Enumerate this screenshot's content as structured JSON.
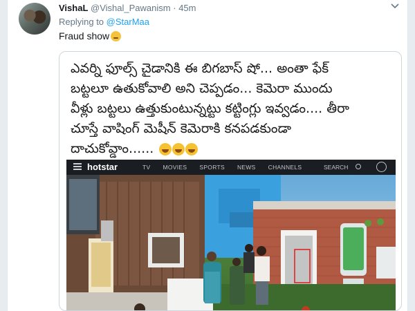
{
  "tweet": {
    "name": "VishaL",
    "handle": "@Vishal_Pawanism",
    "separator": "·",
    "time": "45m",
    "replying_prefix": "Replying to",
    "replying_to": "@StarMaa",
    "text": "Fraud show",
    "caret_icon": "chevron-down-icon"
  },
  "quote": {
    "line1": "ఎవర్ని ఫూల్స్ చైడానికి ఈ బిగబాస్ షో... అంతా ఫేక్",
    "line2": "బట్టలూ ఉతుకోవాలి అని చెప్పడం... కెమెరా ముందు",
    "line3": "వీళ్లు బట్టలు ఉత్తుకుంటున్నట్టు కట్టింగ్లు ఇవ్వడం.... తీరా",
    "line4": "చూస్తే వాషింగ్ మెషీన్ కెమెరాకి కనపడకుండా",
    "line5": "దాచుకోవ్డాం......"
  },
  "hotstar": {
    "logo": "hotstar",
    "nav": [
      "TV",
      "MOVIES",
      "SPORTS",
      "NEWS",
      "CHANNELS"
    ],
    "search": "SEARCH"
  },
  "colors": {
    "link": "#1da1f2",
    "muted": "#657786",
    "highlight_box": "#e0262a"
  }
}
